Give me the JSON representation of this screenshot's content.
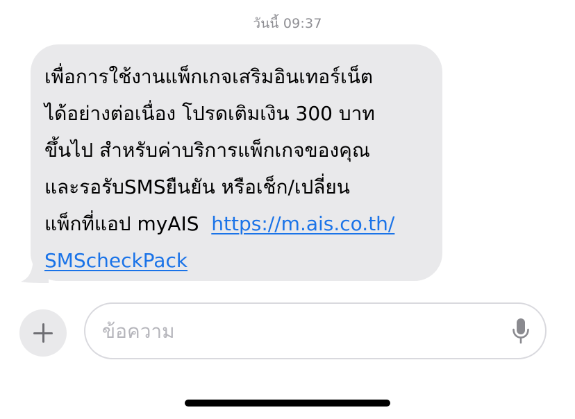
{
  "conversation": {
    "timestamp": "วันนี้ 09:37",
    "message": {
      "lines": [
        "เพื่อการใช้งานแพ็กเกจเสริมอินเทอร์เน็ต",
        "ได้อย่างต่อเนื่อง โปรดเติมเงิน 300 บาท",
        "ขึ้นไป สำหรับค่าบริการแพ็กเกจของคุณ",
        "และรอรับSMSยืนยัน หรือเช็ก/เปลี่ยน",
        "แพ็กที่แอป myAIS  "
      ],
      "link_part1": "https://m.ais.co.th/",
      "link_part2": "SMScheckPack"
    }
  },
  "composer": {
    "placeholder": "ข้อความ",
    "value": ""
  },
  "icons": {
    "plus": "plus-icon",
    "microphone": "microphone-icon"
  },
  "colors": {
    "bubble_background": "#e9e9eb",
    "link": "#1a73e8",
    "timestamp": "#8e8e93",
    "placeholder": "#b5b5bb"
  }
}
